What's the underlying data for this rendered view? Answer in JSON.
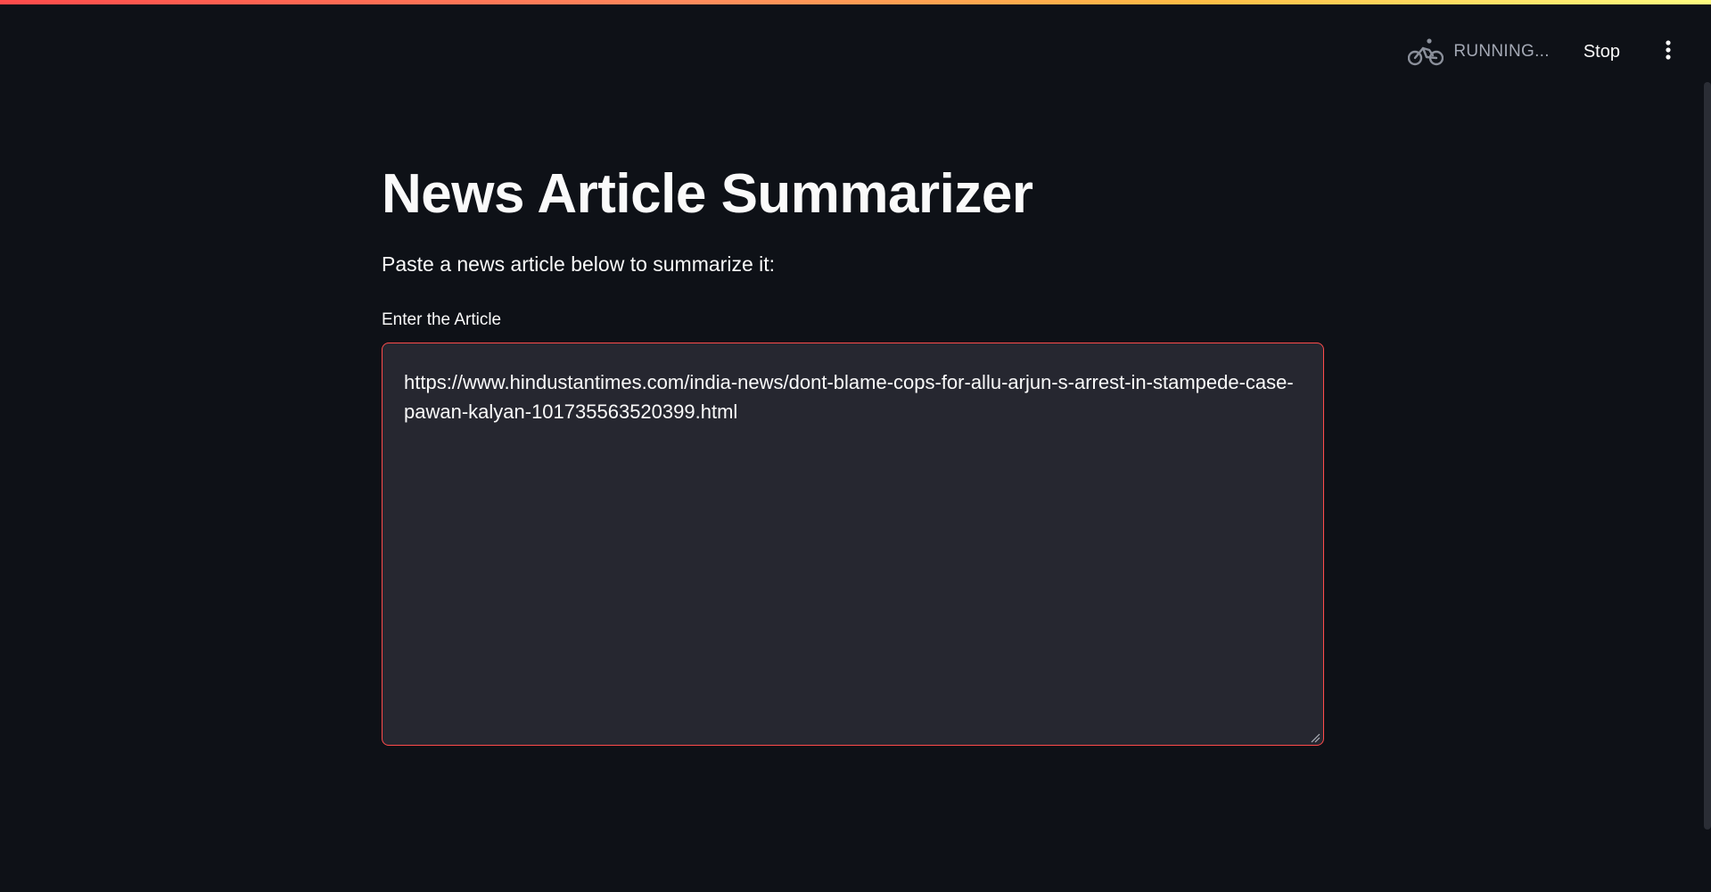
{
  "header": {
    "status_text": "RUNNING...",
    "status_icon": "bicycle-icon",
    "stop_label": "Stop",
    "menu_icon": "kebab-menu-icon"
  },
  "main": {
    "title": "News Article Summarizer",
    "subtitle": "Paste a news article below to summarize it:",
    "article_field": {
      "label": "Enter the Article",
      "value": "https://www.hindustantimes.com/india-news/dont-blame-cops-for-allu-arjun-s-arrest-in-stampede-case-pawan-kalyan-101735563520399.html"
    }
  },
  "colors": {
    "background": "#0e1117",
    "input_background": "#262730",
    "focus_border": "#ff4b4b",
    "text": "#fafafa",
    "muted_text": "#a3a8b4"
  }
}
